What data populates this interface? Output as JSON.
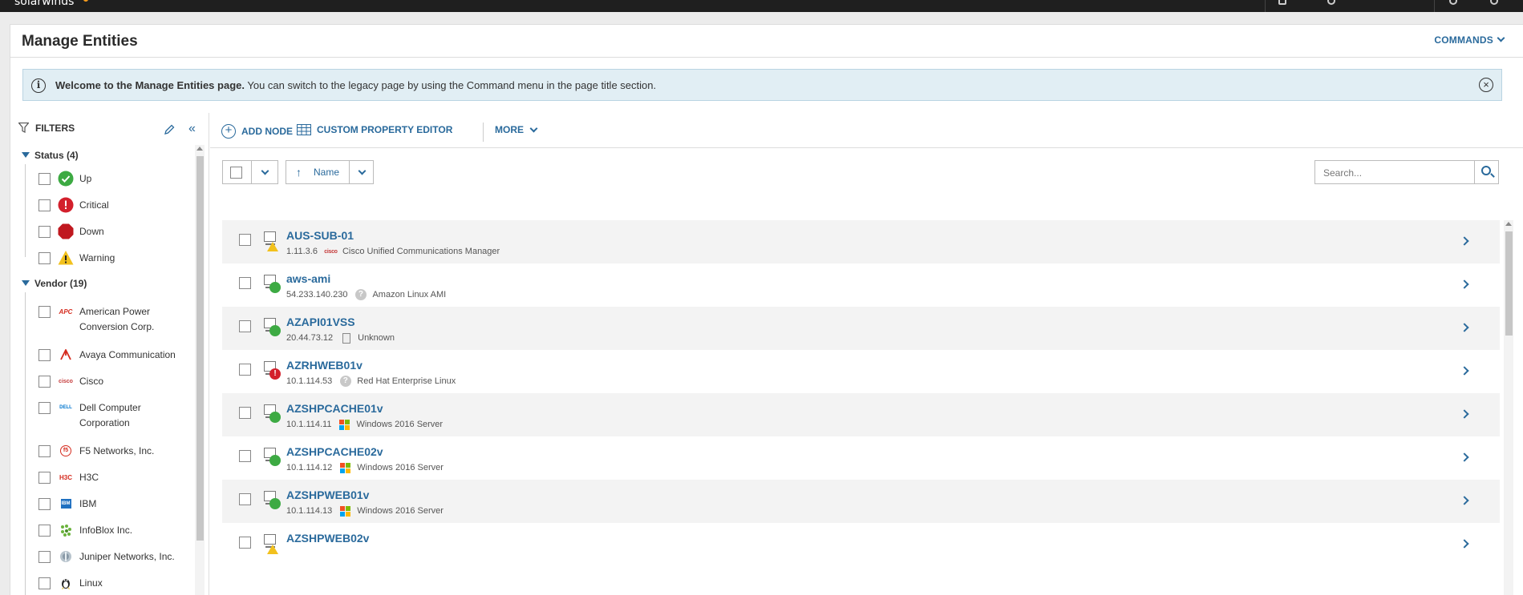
{
  "topbar": {
    "brand": "solarwinds"
  },
  "header": {
    "title": "Manage Entities",
    "commands_label": "COMMANDS"
  },
  "banner": {
    "bold": "Welcome to the Manage Entities page.",
    "text": " You can switch to the legacy page by using the Command menu in the page title section."
  },
  "filters": {
    "title": "FILTERS",
    "status": {
      "label": "Status (4)",
      "items": [
        {
          "label": "Up",
          "icon": "status-up-icon"
        },
        {
          "label": "Critical",
          "icon": "status-critical-icon"
        },
        {
          "label": "Down",
          "icon": "status-down-icon"
        },
        {
          "label": "Warning",
          "icon": "status-warning-icon"
        }
      ]
    },
    "vendor": {
      "label": "Vendor (19)",
      "items": [
        {
          "label": "American Power Conversion Corp.",
          "icon": "apc-logo-icon",
          "icon_text": "APC"
        },
        {
          "label": "Avaya Communication",
          "icon": "avaya-logo-icon",
          "icon_text": ""
        },
        {
          "label": "Cisco",
          "icon": "cisco-logo-icon",
          "icon_text": "cisco"
        },
        {
          "label": "Dell Computer Corporation",
          "icon": "dell-logo-icon",
          "icon_text": "DELL"
        },
        {
          "label": "F5 Networks, Inc.",
          "icon": "f5-logo-icon",
          "icon_text": "f5"
        },
        {
          "label": "H3C",
          "icon": "h3c-logo-icon",
          "icon_text": "H3C"
        },
        {
          "label": "IBM",
          "icon": "ibm-logo-icon",
          "icon_text": "IBM"
        },
        {
          "label": "InfoBlox Inc.",
          "icon": "infoblox-logo-icon",
          "icon_text": ""
        },
        {
          "label": "Juniper Networks, Inc.",
          "icon": "juniper-logo-icon",
          "icon_text": ""
        },
        {
          "label": "Linux",
          "icon": "linux-logo-icon",
          "icon_text": ""
        }
      ]
    }
  },
  "toolbar": {
    "add_node": "ADD NODE",
    "custom_property_editor": "CUSTOM PROPERTY EDITOR",
    "more": "MORE"
  },
  "sort": {
    "label": "Name"
  },
  "search": {
    "placeholder": "Search..."
  },
  "nodes": [
    {
      "name": "AUS-SUB-01",
      "ip": "1.11.3.6",
      "os": "Cisco Unified Communications Manager",
      "status": "warning",
      "vendor_icon": "cisco-logo-icon"
    },
    {
      "name": "aws-ami",
      "ip": "54.233.140.230",
      "os": "Amazon Linux AMI",
      "status": "up",
      "vendor_icon": "unknown-vendor-icon"
    },
    {
      "name": "AZAPI01VSS",
      "ip": "20.44.73.12",
      "os": "Unknown",
      "status": "up",
      "vendor_icon": "server-icon"
    },
    {
      "name": "AZRHWEB01v",
      "ip": "10.1.114.53",
      "os": "Red Hat Enterprise Linux",
      "status": "critical",
      "vendor_icon": "unknown-vendor-icon"
    },
    {
      "name": "AZSHPCACHE01v",
      "ip": "10.1.114.11",
      "os": "Windows 2016 Server",
      "status": "up",
      "vendor_icon": "windows-logo-icon"
    },
    {
      "name": "AZSHPCACHE02v",
      "ip": "10.1.114.12",
      "os": "Windows 2016 Server",
      "status": "up",
      "vendor_icon": "windows-logo-icon"
    },
    {
      "name": "AZSHPWEB01v",
      "ip": "10.1.114.13",
      "os": "Windows 2016 Server",
      "status": "up",
      "vendor_icon": "windows-logo-icon"
    },
    {
      "name": "AZSHPWEB02v",
      "ip": "",
      "os": "",
      "status": "warning",
      "vendor_icon": ""
    }
  ],
  "colors": {
    "accent": "#2a6a9c",
    "status_up": "#3daa43",
    "status_critical": "#d3202c",
    "status_down": "#c0181f",
    "status_warning": "#f2c11d",
    "banner_bg": "#e1eef4"
  }
}
